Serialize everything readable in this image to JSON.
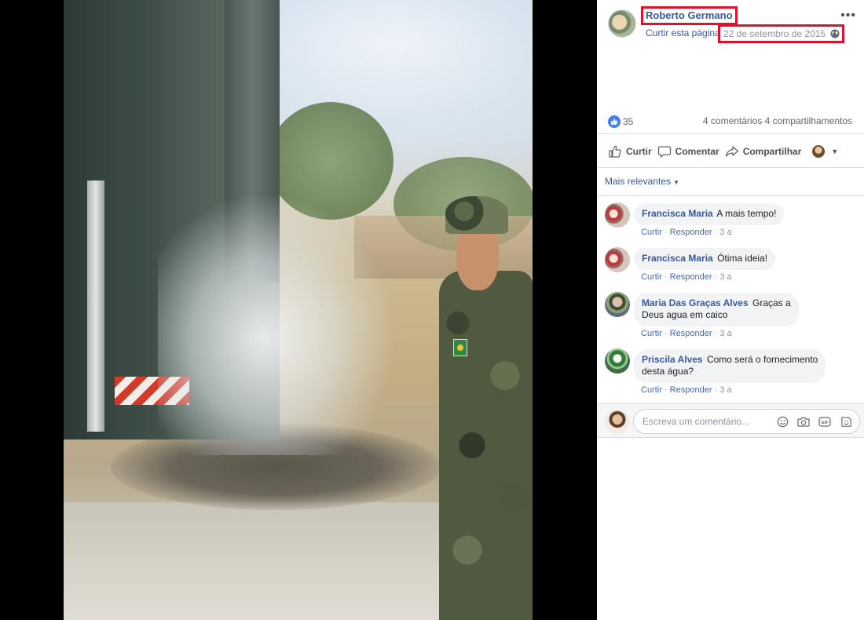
{
  "post": {
    "author": "Roberto Germano",
    "like_page": "Curtir esta página",
    "date": "22 de setembro de 2015",
    "more_icon": "more-horizontal-icon",
    "privacy_icon": "globe-icon"
  },
  "stats": {
    "likes": "35",
    "comments": "4 comentários",
    "shares": "4 compartilhamentos"
  },
  "actions": {
    "like": "Curtir",
    "comment": "Comentar",
    "share": "Compartilhar"
  },
  "sort": {
    "label": "Mais relevantes"
  },
  "comments": [
    {
      "name": "Francisca Maria",
      "text": "A mais tempo!",
      "like": "Curtir",
      "reply": "Responder",
      "time": "3 a"
    },
    {
      "name": "Francisca Maria",
      "text": "Ótima ideia!",
      "like": "Curtir",
      "reply": "Responder",
      "time": "3 a"
    },
    {
      "name": "Maria Das Graças Alves",
      "text": "Graças a",
      "text2": "Deus agua em caico",
      "like": "Curtir",
      "reply": "Responder",
      "time": "3 a"
    },
    {
      "name": "Priscila Alves",
      "text": "Como será o fornecimento",
      "text2": "desta água?",
      "like": "Curtir",
      "reply": "Responder",
      "time": "3 a"
    }
  ],
  "composer": {
    "placeholder": "Escreva um comentário..."
  },
  "colors": {
    "link": "#385898",
    "highlight": "#e0102b",
    "like_blue": "#4080ff"
  }
}
